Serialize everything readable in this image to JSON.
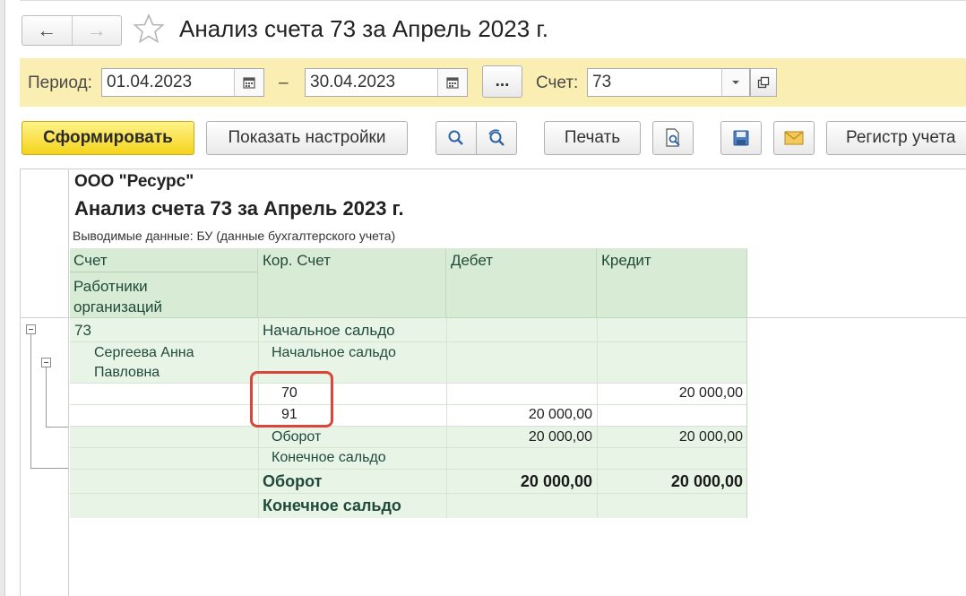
{
  "window": {
    "title": "Анализ счета 73 за Апрель 2023 г."
  },
  "nav": {
    "back": "←",
    "forward": "→"
  },
  "period": {
    "label": "Период:",
    "from": "01.04.2023",
    "dash": "–",
    "to": "30.04.2023",
    "more": "...",
    "account_label": "Счет:",
    "account": "73"
  },
  "toolbar": {
    "generate": "Сформировать",
    "settings": "Показать настройки",
    "print": "Печать",
    "register": "Регистр учета"
  },
  "report": {
    "org": "ООО \"Ресурс\"",
    "title": "Анализ счета 73 за Апрель 2023 г.",
    "subtitle": "Выводимые данные:  БУ (данные бухгалтерского учета)",
    "headers": {
      "account": "Счет",
      "employees_1": "Работники",
      "employees_2": "организаций",
      "corr": "Кор. Счет",
      "debit": "Дебет",
      "credit": "Кредит"
    },
    "rows": [
      {
        "col1": "73",
        "col2": "Начальное сальдо",
        "debit": "",
        "credit": ""
      },
      {
        "col1_a": "Сергеева Анна",
        "col1_b": "Павловна",
        "col2": "Начальное сальдо",
        "debit": "",
        "credit": ""
      },
      {
        "col2": "70",
        "debit": "",
        "credit": "20 000,00"
      },
      {
        "col2": "91",
        "debit": "20 000,00",
        "credit": ""
      },
      {
        "col2": "Оборот",
        "debit": "20 000,00",
        "credit": "20 000,00"
      },
      {
        "col2": "Конечное сальдо",
        "debit": "",
        "credit": ""
      },
      {
        "col2": "Оборот",
        "debit": "20 000,00",
        "credit": "20 000,00"
      },
      {
        "col2": "Конечное сальдо",
        "debit": "",
        "credit": ""
      }
    ]
  },
  "colors": {
    "accent_yellow": "#f5d41b",
    "period_bar": "#fbeeb2",
    "header_green": "#d8ecd5",
    "highlight": "#d9473b"
  }
}
